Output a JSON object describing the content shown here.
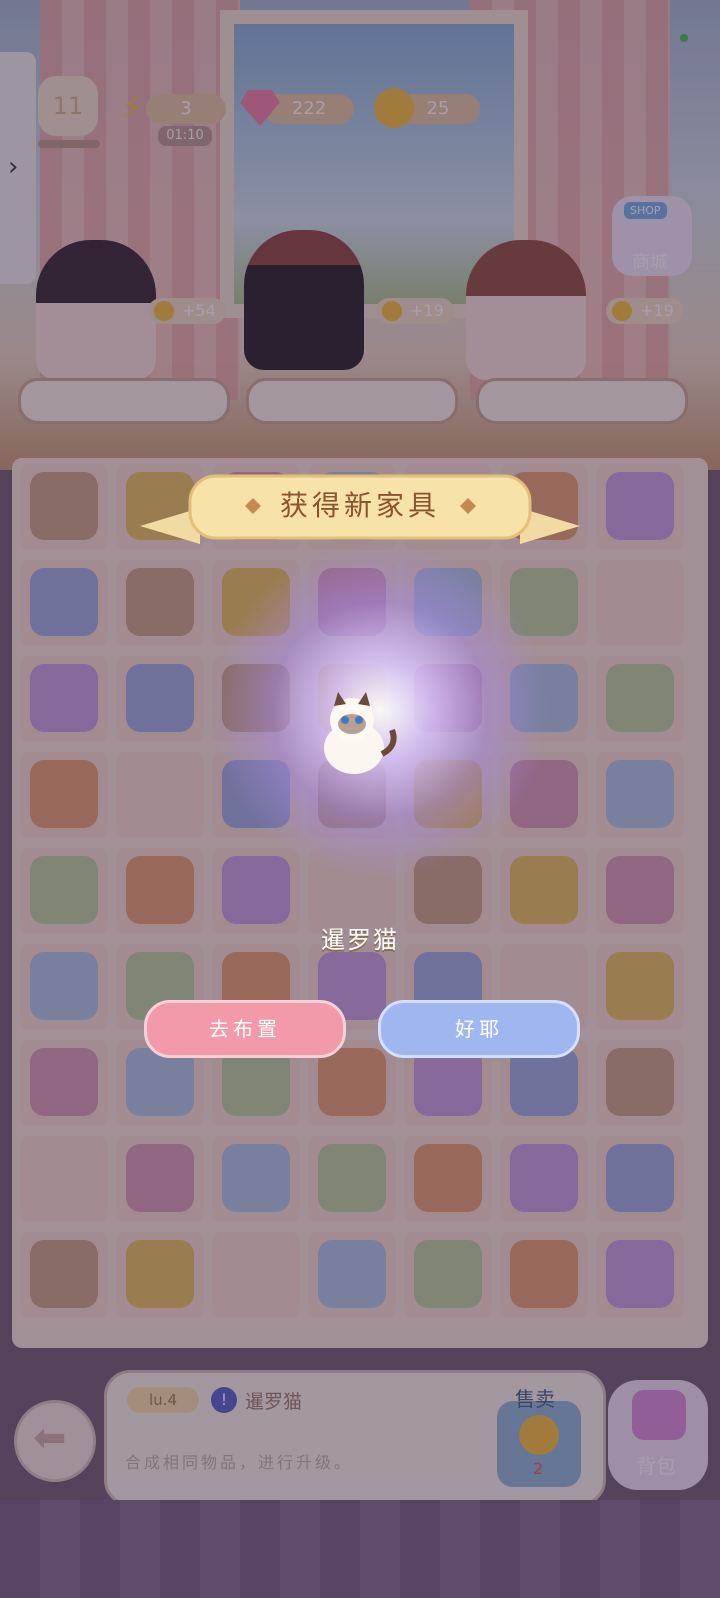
{
  "top_bar": {
    "level": "11",
    "energy": "3",
    "energy_timer": "01:10",
    "gems": "222",
    "coins": "25",
    "shop_badge": "SHOP",
    "shop_label": "商城"
  },
  "characters": [
    {
      "bonus": "+54"
    },
    {
      "bonus": "+19"
    },
    {
      "bonus": "+19"
    }
  ],
  "popup": {
    "title": "获得新家具",
    "item_name": "暹罗猫",
    "place_button": "去布置",
    "ok_button": "好耶",
    "button_colors": {
      "place": "#f29aa9",
      "ok": "#9fb6f0"
    }
  },
  "info_panel": {
    "level": "lu.4",
    "item_name": "暹罗猫",
    "hint": "合成相同物品，进行升级。",
    "sell_label": "售卖",
    "sell_price": "2",
    "bag_label": "背包"
  },
  "colors": {
    "accent_gold": "#f2c032",
    "banner": "#f7e2a8",
    "text_brown": "#a46a3c"
  }
}
